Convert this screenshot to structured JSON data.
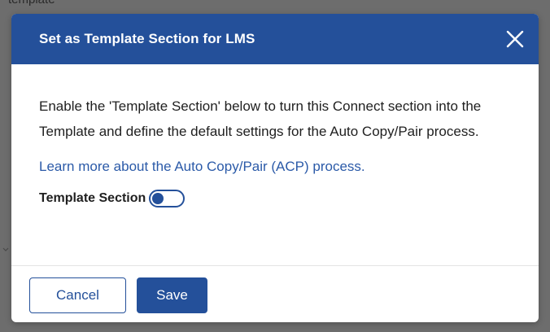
{
  "background": {
    "partial_text": "template"
  },
  "dialog": {
    "title": "Set as Template Section for LMS",
    "close_label": "Close",
    "description": "Enable the 'Template Section' below to turn this Connect section into the Template and define the default settings for the Auto Copy/Pair process.",
    "learn_more_link": "Learn more about the Auto Copy/Pair (ACP) process.",
    "toggle": {
      "label": "Template Section",
      "state": "off"
    },
    "buttons": {
      "cancel": "Cancel",
      "save": "Save"
    }
  },
  "colors": {
    "header_bg": "#24509a",
    "primary": "#24509a",
    "link": "#2b5aa8",
    "backdrop": "#6d6d6d"
  },
  "icons": {
    "close": "close-icon",
    "background_chevron": "chevron-down-icon"
  }
}
